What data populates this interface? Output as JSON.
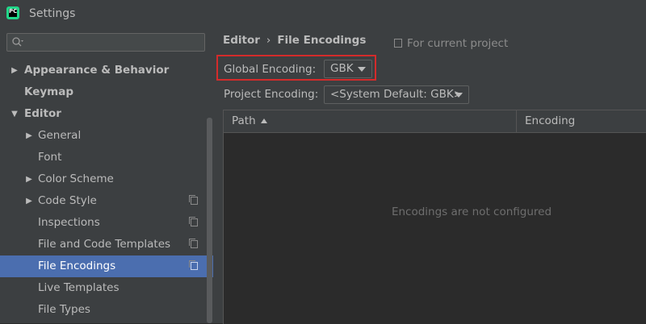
{
  "window": {
    "title": "Settings",
    "app_icon_text": "PC"
  },
  "search": {
    "placeholder": ""
  },
  "sidebar": {
    "items": [
      {
        "label": "Appearance & Behavior"
      },
      {
        "label": "Keymap"
      },
      {
        "label": "Editor"
      },
      {
        "label": "General"
      },
      {
        "label": "Font"
      },
      {
        "label": "Color Scheme"
      },
      {
        "label": "Code Style"
      },
      {
        "label": "Inspections"
      },
      {
        "label": "File and Code Templates"
      },
      {
        "label": "File Encodings"
      },
      {
        "label": "Live Templates"
      },
      {
        "label": "File Types"
      }
    ]
  },
  "breadcrumb": {
    "parent": "Editor",
    "separator": "›",
    "current": "File Encodings"
  },
  "project_hint": "For current project",
  "global_encoding": {
    "label": "Global Encoding:",
    "value": "GBK"
  },
  "project_encoding": {
    "label": "Project Encoding:",
    "value": "<System Default: GBK>"
  },
  "table": {
    "columns": [
      "Path",
      "Encoding"
    ],
    "empty_text": "Encodings are not configured"
  },
  "colors": {
    "selection": "#4b6eaf",
    "highlight_border": "#d42b2b",
    "panel": "#3c3f41",
    "background": "#2b2b2b"
  }
}
